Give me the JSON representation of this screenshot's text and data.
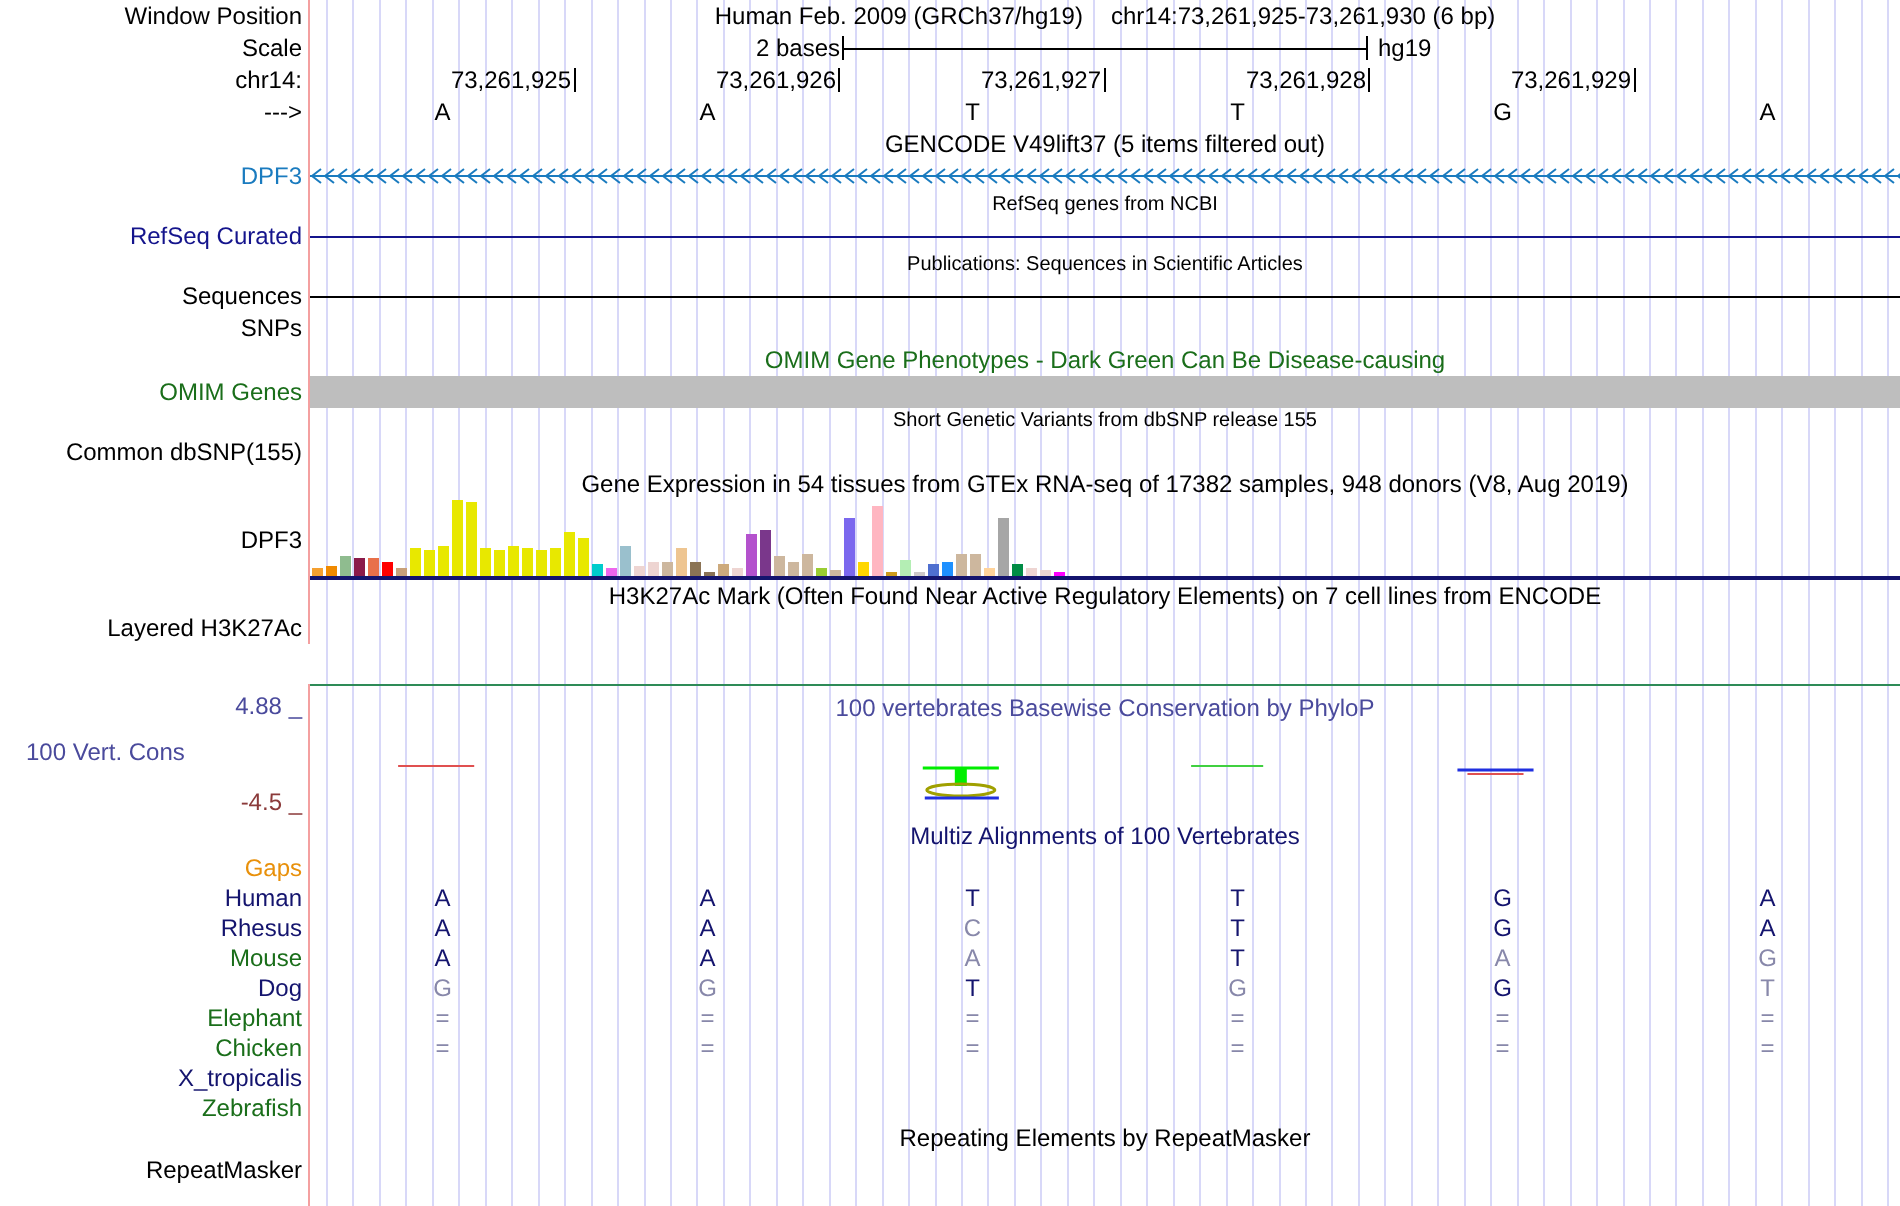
{
  "position": {
    "label": "Window Position",
    "assembly": "Human Feb. 2009 (GRCh37/hg19)",
    "range": "chr14:73,261,925-73,261,930 (6 bp)"
  },
  "scale": {
    "label": "Scale",
    "span": "2 bases",
    "assembly": "hg19"
  },
  "coordinates": {
    "label": "chr14:",
    "ticks": [
      "73,261,925",
      "73,261,926",
      "73,261,927",
      "73,261,928",
      "73,261,929"
    ]
  },
  "bases": {
    "label": "--->",
    "letters": [
      "A",
      "A",
      "T",
      "T",
      "G",
      "A"
    ]
  },
  "tracks": [
    {
      "kind": "gene",
      "title": "GENCODE V49lift37 (5 items filtered out)",
      "compact": false,
      "label": "DPF3",
      "color": "#1a7bbf"
    },
    {
      "kind": "line",
      "title": "RefSeq genes from NCBI",
      "compact": true,
      "label": "RefSeq Curated",
      "color": "#14148c"
    },
    {
      "kind": "line",
      "title": "Publications: Sequences in Scientific Articles",
      "compact": true,
      "label": "Sequences",
      "color": "#000000"
    },
    {
      "kind": "empty",
      "label": "SNPs",
      "color": "#000000"
    },
    {
      "kind": "bar",
      "title": "OMIM Gene Phenotypes - Dark Green Can Be Disease-causing",
      "compact": false,
      "label": "OMIM Genes",
      "color": "#1a6e1a"
    },
    {
      "kind": "empty",
      "title": "Short Genetic Variants from dbSNP release 155",
      "compact": true,
      "label": "Common dbSNP(155)",
      "color": "#000000"
    },
    {
      "kind": "expression",
      "title": "Gene Expression in 54 tissues from GTEx RNA-seq of 17382 samples, 948 donors (V8, Aug 2019)",
      "compact": false,
      "label": "DPF3",
      "color": "#000000"
    },
    {
      "kind": "empty",
      "title": "H3K27Ac Mark (Often Found Near Active Regulatory Elements) on 7 cell lines from ENCODE",
      "compact": false,
      "label": "Layered H3K27Ac",
      "color": "#000000"
    },
    {
      "kind": "conservation",
      "title": "100 vertebrates Basewise Conservation by PhyloP",
      "compact": false,
      "label": "100 Vert. Cons",
      "color": "#4a4a9c",
      "max_label": "4.88 _",
      "min_label": "-4.5 _"
    },
    {
      "kind": "multiz",
      "title": "Multiz Alignments of 100 Vertebrates",
      "compact": false,
      "label": "Gaps",
      "color": "#e8900a",
      "species": [
        {
          "name": "Human",
          "color": "#14146e",
          "bases": [
            {
              "base": "A",
              "match": true
            },
            {
              "base": "A",
              "match": true
            },
            {
              "base": "T",
              "match": true
            },
            {
              "base": "T",
              "match": true
            },
            {
              "base": "G",
              "match": true
            },
            {
              "base": "A",
              "match": true
            }
          ]
        },
        {
          "name": "Rhesus",
          "color": "#14146e",
          "bases": [
            {
              "base": "A",
              "match": true
            },
            {
              "base": "A",
              "match": true
            },
            {
              "base": "C",
              "match": false
            },
            {
              "base": "T",
              "match": true
            },
            {
              "base": "G",
              "match": true
            },
            {
              "base": "A",
              "match": true
            }
          ]
        },
        {
          "name": "Mouse",
          "color": "#1a6e1a",
          "bases": [
            {
              "base": "A",
              "match": true
            },
            {
              "base": "A",
              "match": true
            },
            {
              "base": "A",
              "match": false
            },
            {
              "base": "T",
              "match": true
            },
            {
              "base": "A",
              "match": false
            },
            {
              "base": "G",
              "match": false
            }
          ]
        },
        {
          "name": "Dog",
          "color": "#14146e",
          "bases": [
            {
              "base": "G",
              "match": false
            },
            {
              "base": "G",
              "match": false
            },
            {
              "base": "T",
              "match": true
            },
            {
              "base": "G",
              "match": false
            },
            {
              "base": "G",
              "match": true
            },
            {
              "base": "T",
              "match": false
            }
          ]
        },
        {
          "name": "Elephant",
          "color": "#1a6e1a",
          "bases": [
            {
              "base": "=",
              "match": false
            },
            {
              "base": "=",
              "match": false
            },
            {
              "base": "=",
              "match": false
            },
            {
              "base": "=",
              "match": false
            },
            {
              "base": "=",
              "match": false
            },
            {
              "base": "=",
              "match": false
            }
          ]
        },
        {
          "name": "Chicken",
          "color": "#1a6e1a",
          "bases": [
            {
              "base": "=",
              "match": false
            },
            {
              "base": "=",
              "match": false
            },
            {
              "base": "=",
              "match": false
            },
            {
              "base": "=",
              "match": false
            },
            {
              "base": "=",
              "match": false
            },
            {
              "base": "=",
              "match": false
            }
          ]
        },
        {
          "name": "X_tropicalis",
          "color": "#14146e"
        },
        {
          "name": "Zebrafish",
          "color": "#1a6e1a"
        }
      ]
    },
    {
      "kind": "empty",
      "title": "Repeating Elements by RepeatMasker",
      "compact": false,
      "label": "RepeatMasker",
      "color": "#000000"
    }
  ]
}
